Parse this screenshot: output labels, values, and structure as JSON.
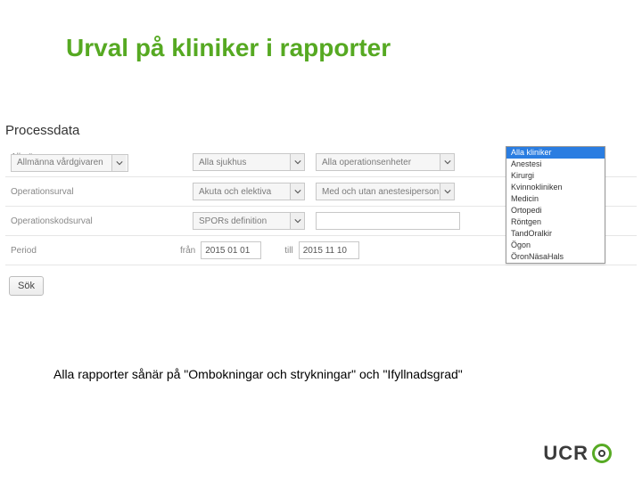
{
  "title": "Urval på kliniker i rapporter",
  "section_heading": "Processdata",
  "rows": {
    "r1": {
      "label": "Allmänna vårdgivaren",
      "s1": "Allmänna vårdgivaren",
      "s2": "Alla sjukhus",
      "s3": "Alla operationsenheter"
    },
    "r2": {
      "label": "Operationsurval",
      "s1": "Akuta och elektiva",
      "s2": "Med och utan anestesiperson"
    },
    "r3": {
      "label": "Operationskodsurval",
      "s1": "SPORs definition"
    },
    "r4": {
      "label": "Period",
      "from_label": "från",
      "from_value": "2015 01 01",
      "to_label": "till",
      "to_value": "2015 11 10"
    }
  },
  "dropdown": {
    "options": [
      "Alla kliniker",
      "Anestesi",
      "Kirurgi",
      "Kvinnokliniken",
      "Medicin",
      "Ortopedi",
      "Röntgen",
      "TandOralkir",
      "Ögon",
      "ÖronNäsaHals"
    ],
    "selected_index": 0
  },
  "buttons": {
    "sok": "Sök"
  },
  "footnote": "Alla rapporter sånär på \"Ombokningar och strykningar\" och \"Ifyllnadsgrad\"",
  "logo": {
    "text": "UCR"
  }
}
